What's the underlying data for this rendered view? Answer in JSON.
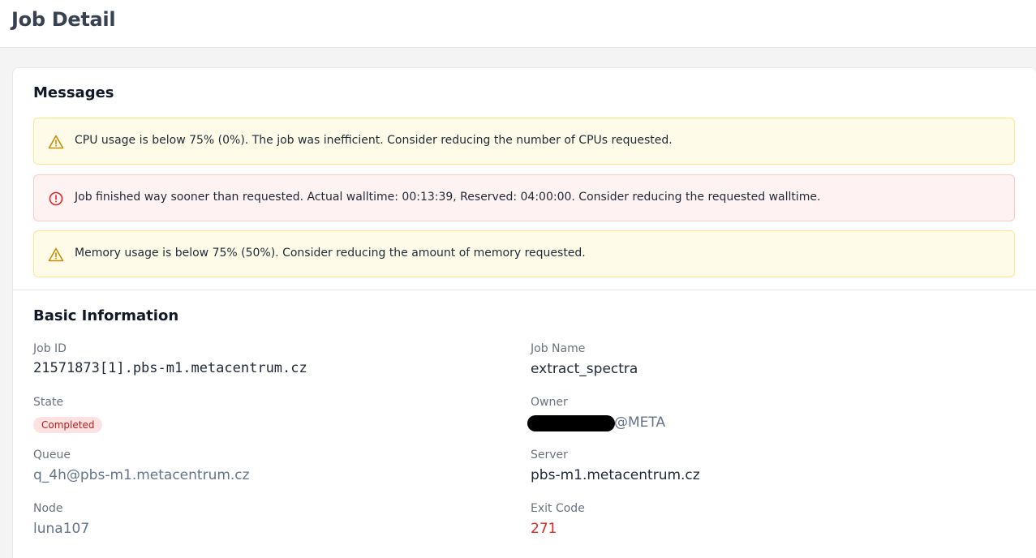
{
  "header": {
    "title": "Job Detail"
  },
  "messages": {
    "title": "Messages",
    "items": [
      {
        "level": "warning",
        "icon": "warning-triangle-icon",
        "text": "CPU usage is below 75% (0%). The job was inefficient. Consider reducing the number of CPUs requested."
      },
      {
        "level": "error",
        "icon": "error-circle-icon",
        "text": "Job finished way sooner than requested. Actual walltime: 00:13:39, Reserved: 04:00:00. Consider reducing the requested walltime."
      },
      {
        "level": "warning",
        "icon": "warning-triangle-icon",
        "text": "Memory usage is below 75% (50%). Consider reducing the amount of memory requested."
      }
    ]
  },
  "basic_info": {
    "title": "Basic Information",
    "job_id": {
      "label": "Job ID",
      "value": "21571873[1].pbs-m1.metacentrum.cz"
    },
    "job_name": {
      "label": "Job Name",
      "value": "extract_spectra"
    },
    "state": {
      "label": "State",
      "value": "Completed"
    },
    "owner": {
      "label": "Owner",
      "value": "@META"
    },
    "queue": {
      "label": "Queue",
      "value": "q_4h@pbs-m1.metacentrum.cz"
    },
    "server": {
      "label": "Server",
      "value": "pbs-m1.metacentrum.cz"
    },
    "node": {
      "label": "Node",
      "value": "luna107"
    },
    "exit_code": {
      "label": "Exit Code",
      "value": "271"
    }
  },
  "colors": {
    "warning_bg": "#fefce8",
    "warning_icon": "#ca8a04",
    "error_bg": "#fef2f2",
    "error_icon": "#dc2626",
    "badge_bg": "#fee2e2",
    "exit_code": "#dc2626"
  }
}
